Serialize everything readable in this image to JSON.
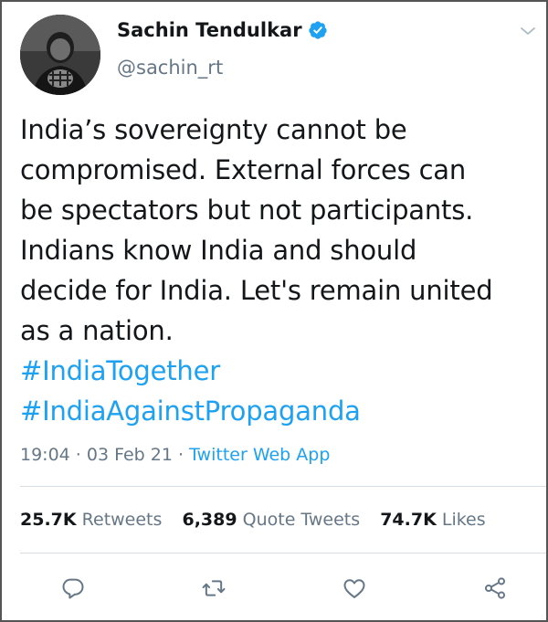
{
  "user": {
    "display_name": "Sachin Tendulkar",
    "handle": "@sachin_rt",
    "verified": true
  },
  "tweet": {
    "text_lines": [
      "India’s sovereignty cannot be",
      "compromised. External forces can",
      "be spectators but not participants.",
      "Indians know India and should",
      "decide for India. Let's remain united",
      "as a nation."
    ],
    "hashtags": [
      "#IndiaTogether",
      "#IndiaAgainstPropaganda"
    ],
    "time": "19:04",
    "date": "03 Feb 21",
    "separator": " · ",
    "source": "Twitter Web App"
  },
  "stats": {
    "retweets": {
      "count": "25.7K",
      "label": "Retweets"
    },
    "quote_tweets": {
      "count": "6,389",
      "label": "Quote Tweets"
    },
    "likes": {
      "count": "74.7K",
      "label": "Likes"
    }
  },
  "icons": {
    "reply": "reply-icon",
    "retweet": "retweet-icon",
    "like": "heart-icon",
    "share": "share-icon",
    "verified": "verified-badge-icon",
    "more": "chevron-down-icon"
  },
  "colors": {
    "link": "#1da1f2",
    "secondary_text": "#657786",
    "primary_text": "#14171a",
    "divider": "#d8dde1"
  }
}
